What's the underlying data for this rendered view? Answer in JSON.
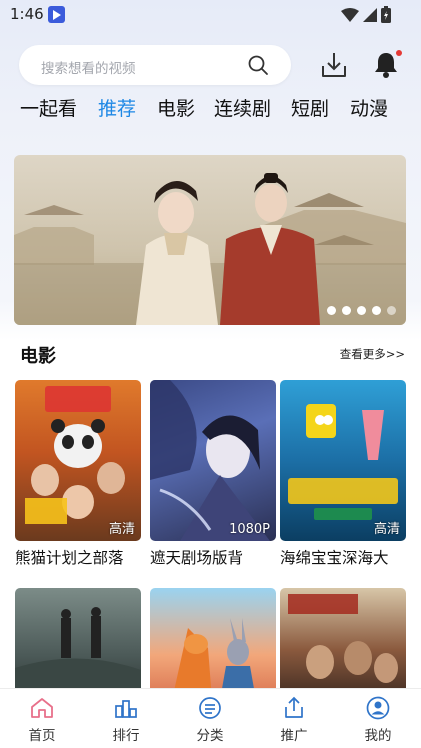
{
  "status_bar": {
    "time": "1:46"
  },
  "search": {
    "placeholder": "搜索想看的视频"
  },
  "tabs": [
    {
      "label": "一起看",
      "active": false
    },
    {
      "label": "推荐",
      "active": true
    },
    {
      "label": "电影",
      "active": false
    },
    {
      "label": "连续剧",
      "active": false
    },
    {
      "label": "短剧",
      "active": false
    },
    {
      "label": "动漫",
      "active": false
    }
  ],
  "banner": {
    "slide_count": 5,
    "current_slide": 5
  },
  "section": {
    "title": "电影",
    "see_more": "查看更多>>"
  },
  "movies": [
    {
      "title": "熊猫计划之部落",
      "quality": "高清"
    },
    {
      "title": "遮天剧场版背",
      "quality": "1080P"
    },
    {
      "title": "海绵宝宝深海大",
      "quality": "高清"
    }
  ],
  "nav": [
    {
      "label": "首页",
      "icon": "home-icon",
      "active": true
    },
    {
      "label": "排行",
      "icon": "ranking-icon",
      "active": false
    },
    {
      "label": "分类",
      "icon": "category-icon",
      "active": false
    },
    {
      "label": "推广",
      "icon": "share-icon",
      "active": false
    },
    {
      "label": "我的",
      "icon": "profile-icon",
      "active": false
    }
  ],
  "colors": {
    "accent": "#1e88e5",
    "home_active": "#e8708a",
    "nav_icon": "#2f74c9"
  }
}
